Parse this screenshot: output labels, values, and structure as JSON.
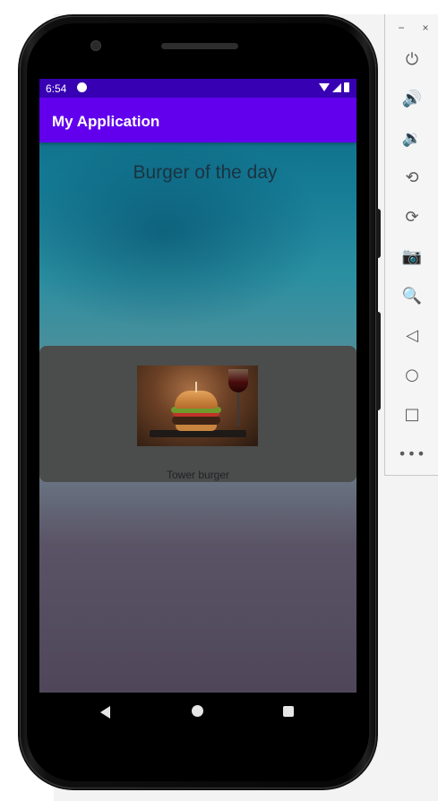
{
  "status_bar": {
    "time": "6:54"
  },
  "app": {
    "title": "My Application"
  },
  "content": {
    "headline": "Burger of the day",
    "card_caption": "Tower burger"
  },
  "emulator_toolbar": {
    "minimize": "−",
    "close": "×",
    "buttons": [
      {
        "icon": "power-icon",
        "glyph": "⏻"
      },
      {
        "icon": "volume-up-icon",
        "glyph": "🔊"
      },
      {
        "icon": "volume-down-icon",
        "glyph": "🔉"
      },
      {
        "icon": "rotate-left-icon",
        "glyph": "⟲"
      },
      {
        "icon": "rotate-right-icon",
        "glyph": "⟳"
      },
      {
        "icon": "camera-icon",
        "glyph": "📷"
      },
      {
        "icon": "zoom-icon",
        "glyph": "🔍"
      },
      {
        "icon": "back-icon",
        "glyph": "◁"
      },
      {
        "icon": "home-icon",
        "glyph": "○"
      },
      {
        "icon": "overview-icon",
        "glyph": "□"
      },
      {
        "icon": "more-icon",
        "glyph": "•••"
      }
    ]
  },
  "colors": {
    "status_bar": "#3700b3",
    "app_bar": "#6200ee",
    "card": "#4b4c4c"
  }
}
